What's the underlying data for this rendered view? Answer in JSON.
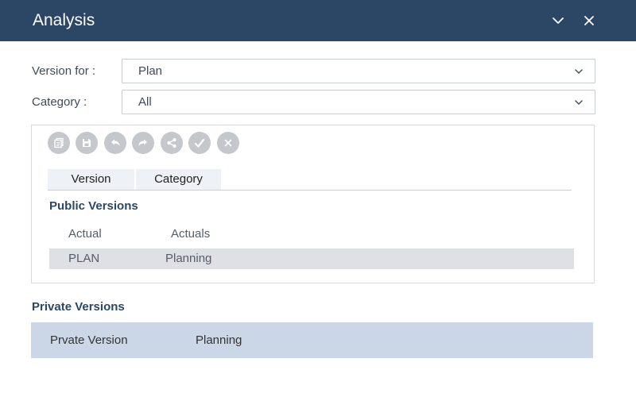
{
  "dialog": {
    "title": "Analysis",
    "title_bg_color": "#2c4766"
  },
  "form": {
    "version_for": {
      "label": "Version for :",
      "value": "Plan"
    },
    "category": {
      "label": "Category :",
      "value": "All"
    }
  },
  "toolbar": {
    "buttons": [
      {
        "icon": "copy-icon"
      },
      {
        "icon": "save-icon"
      },
      {
        "icon": "undo-icon"
      },
      {
        "icon": "redo-icon"
      },
      {
        "icon": "share-icon"
      },
      {
        "icon": "approve-icon"
      },
      {
        "icon": "close-icon"
      }
    ]
  },
  "tabs": [
    {
      "label": "Version"
    },
    {
      "label": "Category"
    }
  ],
  "public_versions": {
    "title": "Public Versions",
    "rows": [
      {
        "version": "Actual",
        "category": "Actuals",
        "selected": false
      },
      {
        "version": "PLAN",
        "category": "Planning",
        "selected": true
      }
    ],
    "selected_row_color": "#dfe0e5"
  },
  "private_versions": {
    "title": "Private Versions",
    "rows": [
      {
        "version": "Prvate Version",
        "category": "Planning"
      }
    ],
    "row_color": "#cbd7e6"
  }
}
